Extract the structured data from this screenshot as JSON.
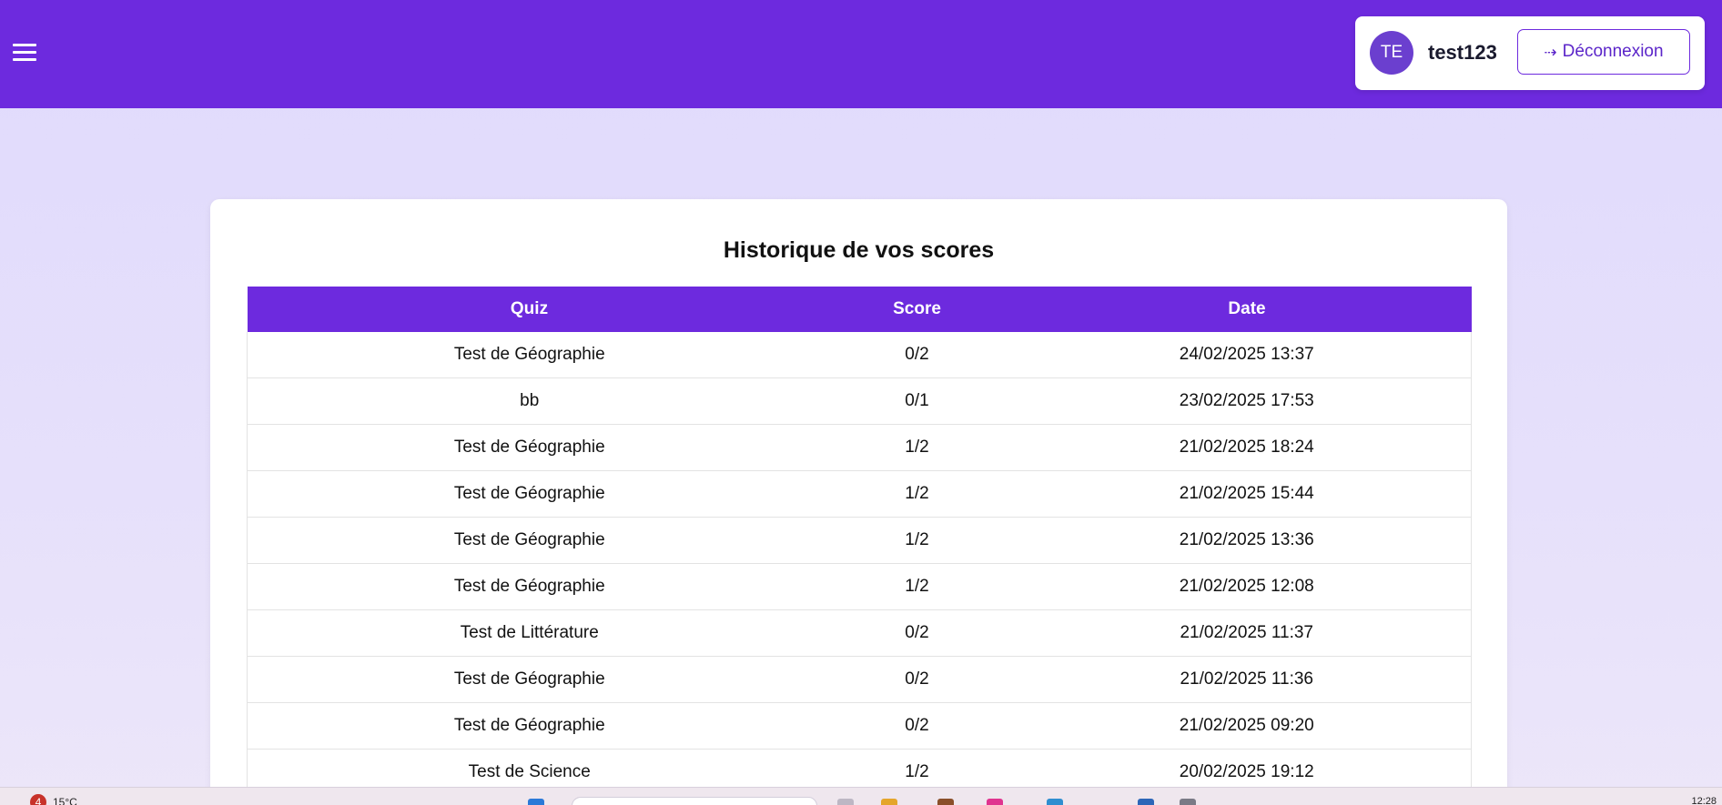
{
  "header": {
    "menu_icon": "hamburger-menu-icon",
    "avatar_initials": "TE",
    "username": "test123",
    "logout_label": "Déconnexion",
    "logout_icon": "arrow-right-icon",
    "colors": {
      "header_bg": "#6d2ade",
      "page_bg": "#e0dafc",
      "accent": "#6d2ade",
      "avatar_bg": "#6b3fcf"
    }
  },
  "main": {
    "title": "Historique de vos scores",
    "table": {
      "columns": [
        "Quiz",
        "Score",
        "Date"
      ],
      "rows": [
        {
          "quiz": "Test de Géographie",
          "score": "0/2",
          "date": "24/02/2025 13:37"
        },
        {
          "quiz": "bb",
          "score": "0/1",
          "date": "23/02/2025 17:53"
        },
        {
          "quiz": "Test de Géographie",
          "score": "1/2",
          "date": "21/02/2025 18:24"
        },
        {
          "quiz": "Test de Géographie",
          "score": "1/2",
          "date": "21/02/2025 15:44"
        },
        {
          "quiz": "Test de Géographie",
          "score": "1/2",
          "date": "21/02/2025 13:36"
        },
        {
          "quiz": "Test de Géographie",
          "score": "1/2",
          "date": "21/02/2025 12:08"
        },
        {
          "quiz": "Test de Littérature",
          "score": "0/2",
          "date": "21/02/2025 11:37"
        },
        {
          "quiz": "Test de Géographie",
          "score": "0/2",
          "date": "21/02/2025 11:36"
        },
        {
          "quiz": "Test de Géographie",
          "score": "0/2",
          "date": "21/02/2025 09:20"
        },
        {
          "quiz": "Test de Science",
          "score": "1/2",
          "date": "20/02/2025 19:12"
        }
      ]
    }
  },
  "taskbar": {
    "weather_badge": "4",
    "weather_temp": "15°C",
    "clock": "12:28"
  }
}
